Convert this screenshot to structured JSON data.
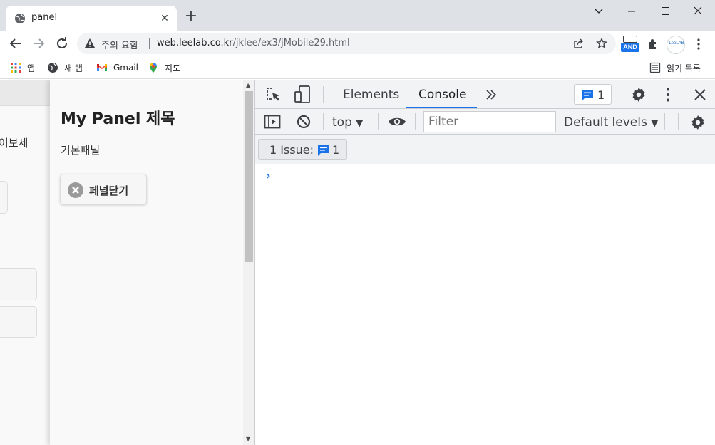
{
  "browser": {
    "tab": {
      "title": "panel"
    },
    "new_tab_label": "+",
    "address": {
      "warning_text": "주의 요함",
      "url_host": "web.leelab.co.kr",
      "url_path": "/jklee/ex3/jMobile29.html"
    },
    "extensions": {
      "and_label": "AND",
      "leelab_label": "LeeLAB"
    },
    "bookmarks": {
      "apps": "앱",
      "new_tab": "새 탭",
      "gmail": "Gmail",
      "maps": "지도",
      "reading_list": "읽기 목록"
    }
  },
  "page": {
    "underlying_text": "어보세",
    "panel": {
      "title": "My Panel 제목",
      "text": "기본패널",
      "close_button": "페널닫기"
    }
  },
  "devtools": {
    "tabs": [
      "Elements",
      "Console"
    ],
    "active_tab": "Console",
    "messages_count": "1",
    "context": "top",
    "filter_placeholder": "Filter",
    "levels": "Default levels",
    "issues_label": "1 Issue:",
    "issues_count": "1",
    "prompt": "›"
  },
  "colors": {
    "accent": "#1a73e8",
    "tabstrip": "#dee1e6",
    "panel_bg": "#f9f9f9"
  }
}
